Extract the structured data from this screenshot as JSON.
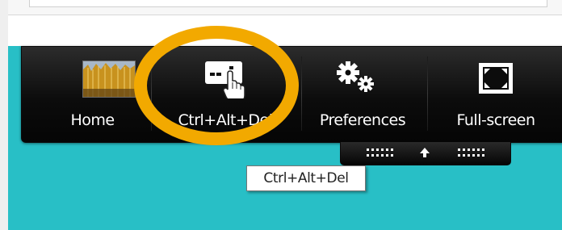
{
  "toolbar": {
    "items": [
      {
        "label": "Home",
        "icon": "home-thumbnail"
      },
      {
        "label": "Ctrl+Alt+Del",
        "icon": "ctrl-alt-del-icon"
      },
      {
        "label": "Preferences",
        "icon": "gears-icon"
      },
      {
        "label": "Full-screen",
        "icon": "fullscreen-icon"
      }
    ],
    "pull_tab_icon": "arrow-up-icon"
  },
  "tooltip": {
    "text": "Ctrl+Alt+Del"
  },
  "colors": {
    "desktop": "#28bfc6",
    "toolbar": "#0c0c0c",
    "highlight": "#f2a900"
  }
}
